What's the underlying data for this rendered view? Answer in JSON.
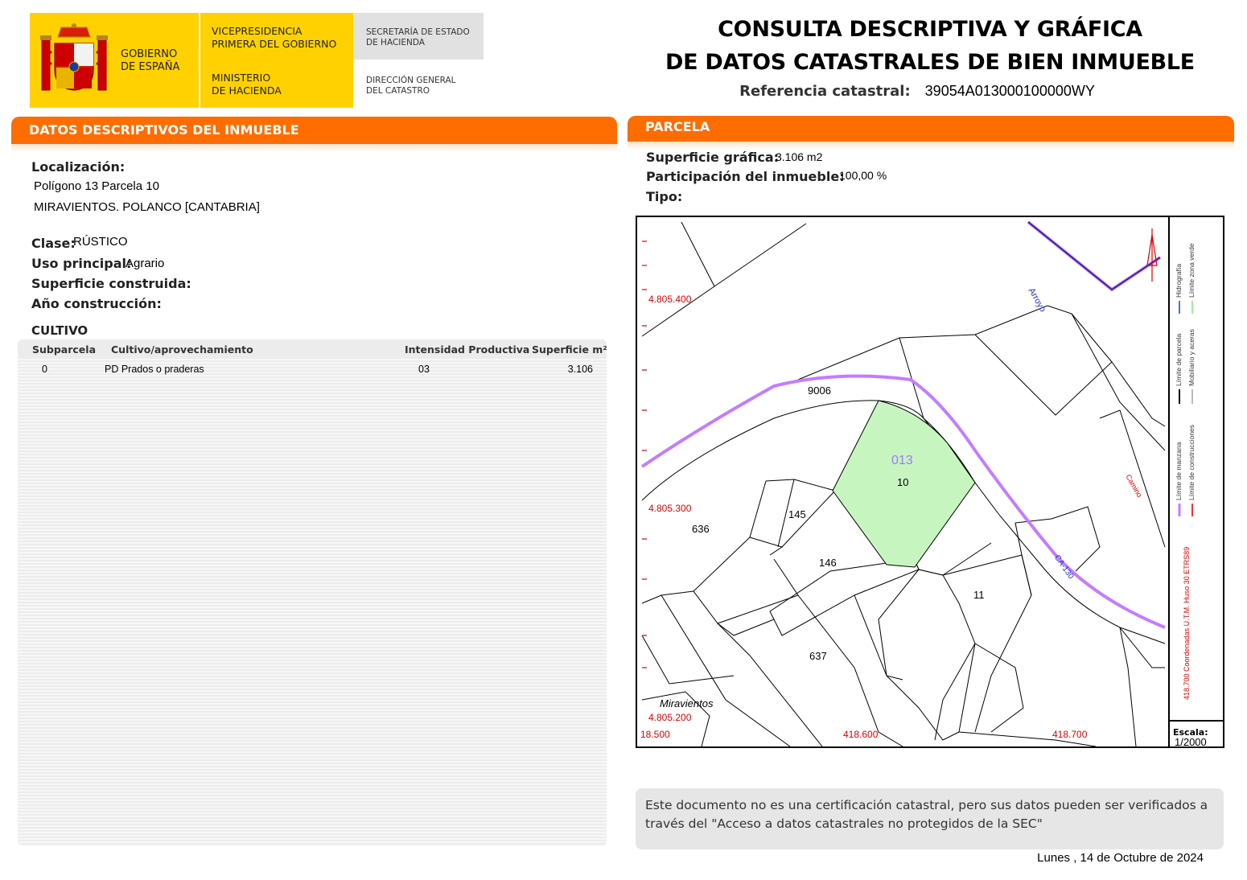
{
  "header": {
    "gov_line1": "GOBIERNO",
    "gov_line2": "DE ESPAÑA",
    "vice_line1": "VICEPRESIDENCIA",
    "vice_line2": "PRIMERA DEL GOBIERNO",
    "min_line1": "MINISTERIO",
    "min_line2": "DE HACIENDA",
    "sec_line1": "SECRETARÍA DE ESTADO",
    "sec_line2": "DE HACIENDA",
    "dir_line1": "DIRECCIÓN GENERAL",
    "dir_line2": "DEL CATASTRO",
    "title_line1": "CONSULTA DESCRIPTIVA Y GRÁFICA",
    "title_line2": "DE DATOS CATASTRALES DE BIEN INMUEBLE",
    "ref_label": "Referencia catastral:",
    "ref_value": "39054A013000100000WY",
    "brand_yellow": "#ffd100",
    "brand_orange": "#ff6c00"
  },
  "descriptive": {
    "section_title": "DATOS DESCRIPTIVOS DEL INMUEBLE",
    "loc_label": "Localización:",
    "loc_line1": "Polígono 13 Parcela 10",
    "loc_line2": "MIRAVIENTOS. POLANCO [CANTABRIA]",
    "clase_label": "Clase:",
    "clase_value": "RÚSTICO",
    "uso_label": "Uso principal:",
    "uso_value": "Agrario",
    "sup_label": "Superficie construida:",
    "anio_label": "Año construcción:",
    "cultivo_title": "CULTIVO",
    "columns": [
      "Subparcela",
      "Cultivo/aprovechamiento",
      "Intensidad Productiva",
      "Superficie m²"
    ],
    "rows": [
      {
        "subparcela": "0",
        "cultivo": "PD Prados o praderas",
        "intensidad": "03",
        "superficie": "3.106"
      }
    ]
  },
  "parcela": {
    "section_title": "PARCELA",
    "sup_label": "Superficie gráfica:",
    "sup_value": "3.106 m2",
    "part_label": "Participación del inmueble:",
    "part_value": "100,00 %",
    "tipo_label": "Tipo:"
  },
  "map": {
    "coord_y1": "4.805.400",
    "coord_y2": "4.805.300",
    "coord_y3": "4.805.200",
    "coord_x0": "18.500",
    "coord_x1": "418.600",
    "coord_x2": "418.700",
    "lbl_9006": "9006",
    "lbl_013": "013",
    "lbl_10": "10",
    "lbl_145": "145",
    "lbl_636": "636",
    "lbl_146": "146",
    "lbl_11": "11",
    "lbl_637": "637",
    "lbl_place": "Miravientos",
    "lbl_arroyo": "Arroyo",
    "lbl_camino": "Camino",
    "lbl_road": "CA-130",
    "legend_hidro": "Hidrografía",
    "legend_verde": "Límite zona verde",
    "legend_parcela": "Límite de parcela",
    "legend_mobiliario": "Mobiliario y aceras",
    "legend_manzana": "Límite de manzana",
    "legend_construcciones": "Límite de construcciones",
    "legend_coords": "418.700 Coordenadas U.T.M. Huso 30 ETRS89",
    "scale_label": "Escala:",
    "scale_value": "1/2000"
  },
  "footer": {
    "notice": "Este documento no es una certificación catastral, pero sus datos pueden ser verificados a través del \"Acceso a datos catastrales no protegidos de la SEC\"",
    "date": "Lunes , 14 de Octubre de 2024"
  }
}
